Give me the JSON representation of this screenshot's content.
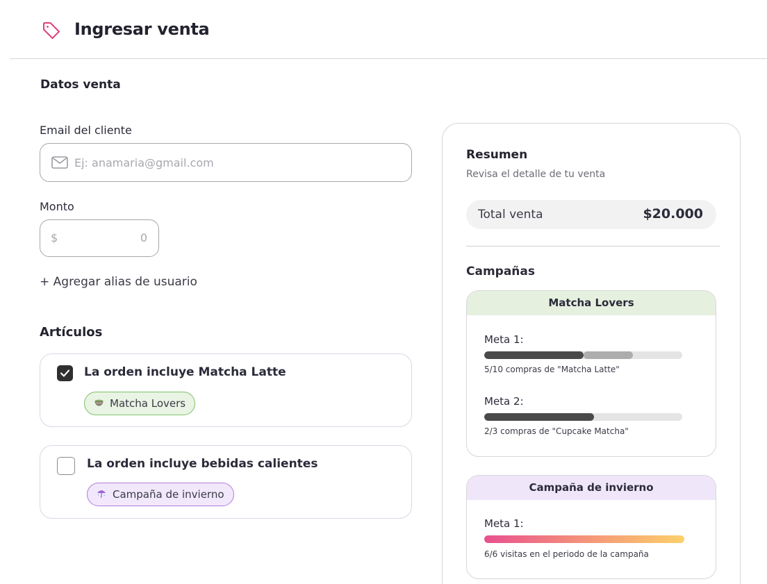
{
  "header": {
    "title": "Ingresar venta",
    "icon": "tag-icon",
    "accent": "#e0407e"
  },
  "form": {
    "section_title": "Datos venta",
    "email": {
      "label": "Email del cliente",
      "placeholder": "Ej: anamaria@gmail.com",
      "value": ""
    },
    "monto": {
      "label": "Monto",
      "currency": "$",
      "value": "0"
    },
    "alias_link": "+ Agregar alias de usuario"
  },
  "articulos": {
    "title": "Artículos",
    "items": [
      {
        "text": "La orden incluye Matcha Latte",
        "checked": true,
        "campaign": "Matcha Lovers",
        "campaign_icon": "matcha-bowl-icon"
      },
      {
        "text": "La orden incluye bebidas calientes",
        "checked": false,
        "campaign": "Campaña de invierno",
        "campaign_icon": "umbrella-icon"
      }
    ]
  },
  "summary": {
    "title": "Resumen",
    "subtitle": "Revisa el detalle de tu venta",
    "total_label": "Total venta",
    "total_value": "$20.000",
    "campaigns_title": "Campañas",
    "campaigns": [
      {
        "name": "Matcha Lovers",
        "color": "#e6f0df",
        "metas": [
          {
            "label": "Meta 1:",
            "note": "5/10 compras de \"Matcha Latte\"",
            "progress": 0.5,
            "pending": 0.25
          },
          {
            "label": "Meta 2:",
            "note": "2/3 compras de \"Cupcake Matcha\"",
            "progress": 0.5556
          }
        ]
      },
      {
        "name": "Campaña de invierno",
        "color": "#f0e6fa",
        "metas": [
          {
            "label": "Meta 1:",
            "note": "6/6 visitas en el periodo de la campaña",
            "progress": 1.0
          }
        ]
      }
    ]
  }
}
